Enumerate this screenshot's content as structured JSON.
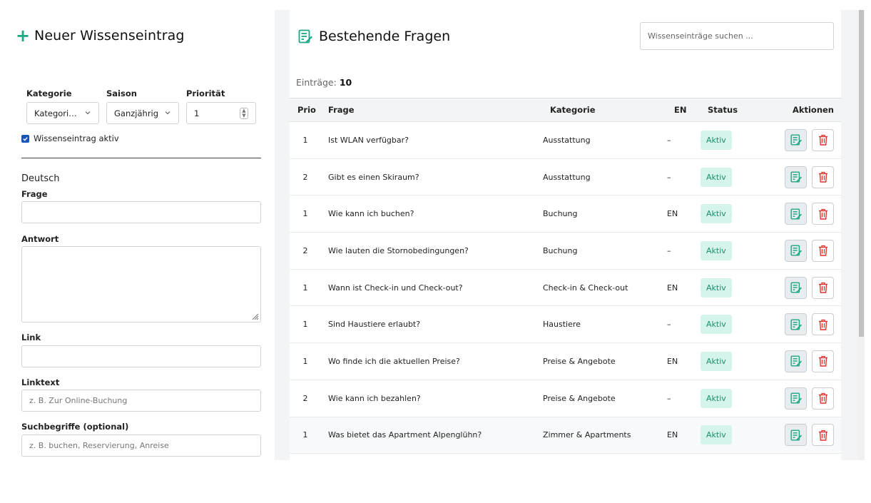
{
  "left": {
    "title": "Neuer Wissenseintrag",
    "filters": {
      "kategorie_label": "Kategorie",
      "kategorie_value": "Kategori…",
      "saison_label": "Saison",
      "saison_value": "Ganzjährig",
      "prioritaet_label": "Priorität",
      "prioritaet_value": "1"
    },
    "active_checkbox_label": "Wissenseintrag aktiv",
    "active_checked": true,
    "language_heading": "Deutsch",
    "frage_label": "Frage",
    "frage_value": "",
    "antwort_label": "Antwort",
    "antwort_value": "",
    "link_label": "Link",
    "link_value": "",
    "linktext_label": "Linktext",
    "linktext_placeholder": "z. B. Zur Online-Buchung",
    "suchbegriffe_label": "Suchbegriffe (optional)",
    "suchbegriffe_placeholder": "z. B. buchen, Reservierung, Anreise"
  },
  "right": {
    "title": "Bestehende Fragen",
    "search_placeholder": "Wissenseinträge suchen ...",
    "count_label": "Einträge:",
    "count_value": "10",
    "columns": {
      "prio": "Prio",
      "frage": "Frage",
      "kategorie": "Kategorie",
      "en": "EN",
      "status": "Status",
      "aktionen": "Aktionen"
    },
    "rows": [
      {
        "prio": "1",
        "frage": "Ist WLAN verfügbar?",
        "kategorie": "Ausstattung",
        "en": "–",
        "status": "Aktiv"
      },
      {
        "prio": "2",
        "frage": "Gibt es einen Skiraum?",
        "kategorie": "Ausstattung",
        "en": "–",
        "status": "Aktiv"
      },
      {
        "prio": "1",
        "frage": "Wie kann ich buchen?",
        "kategorie": "Buchung",
        "en": "EN",
        "status": "Aktiv"
      },
      {
        "prio": "2",
        "frage": "Wie lauten die Stornobedingungen?",
        "kategorie": "Buchung",
        "en": "–",
        "status": "Aktiv"
      },
      {
        "prio": "1",
        "frage": "Wann ist Check-in und Check-out?",
        "kategorie": "Check-in & Check-out",
        "en": "EN",
        "status": "Aktiv"
      },
      {
        "prio": "1",
        "frage": "Sind Haustiere erlaubt?",
        "kategorie": "Haustiere",
        "en": "–",
        "status": "Aktiv"
      },
      {
        "prio": "1",
        "frage": "Wo finde ich die aktuellen Preise?",
        "kategorie": "Preise & Angebote",
        "en": "EN",
        "status": "Aktiv"
      },
      {
        "prio": "2",
        "frage": "Wie kann ich bezahlen?",
        "kategorie": "Preise & Angebote",
        "en": "–",
        "status": "Aktiv"
      },
      {
        "prio": "1",
        "frage": "Was bietet das Apartment Alpenglühn?",
        "kategorie": "Zimmer & Apartments",
        "en": "EN",
        "status": "Aktiv"
      }
    ]
  },
  "colors": {
    "accent": "#1ba784",
    "badge_bg": "#d5f5ec",
    "badge_text": "#1a8f6e",
    "delete_red": "#e03131",
    "checkbox_blue": "#1a56b8"
  },
  "icons": {
    "add": "plus-icon",
    "list": "edit-list-icon",
    "edit": "edit-icon",
    "delete": "trash-icon"
  }
}
